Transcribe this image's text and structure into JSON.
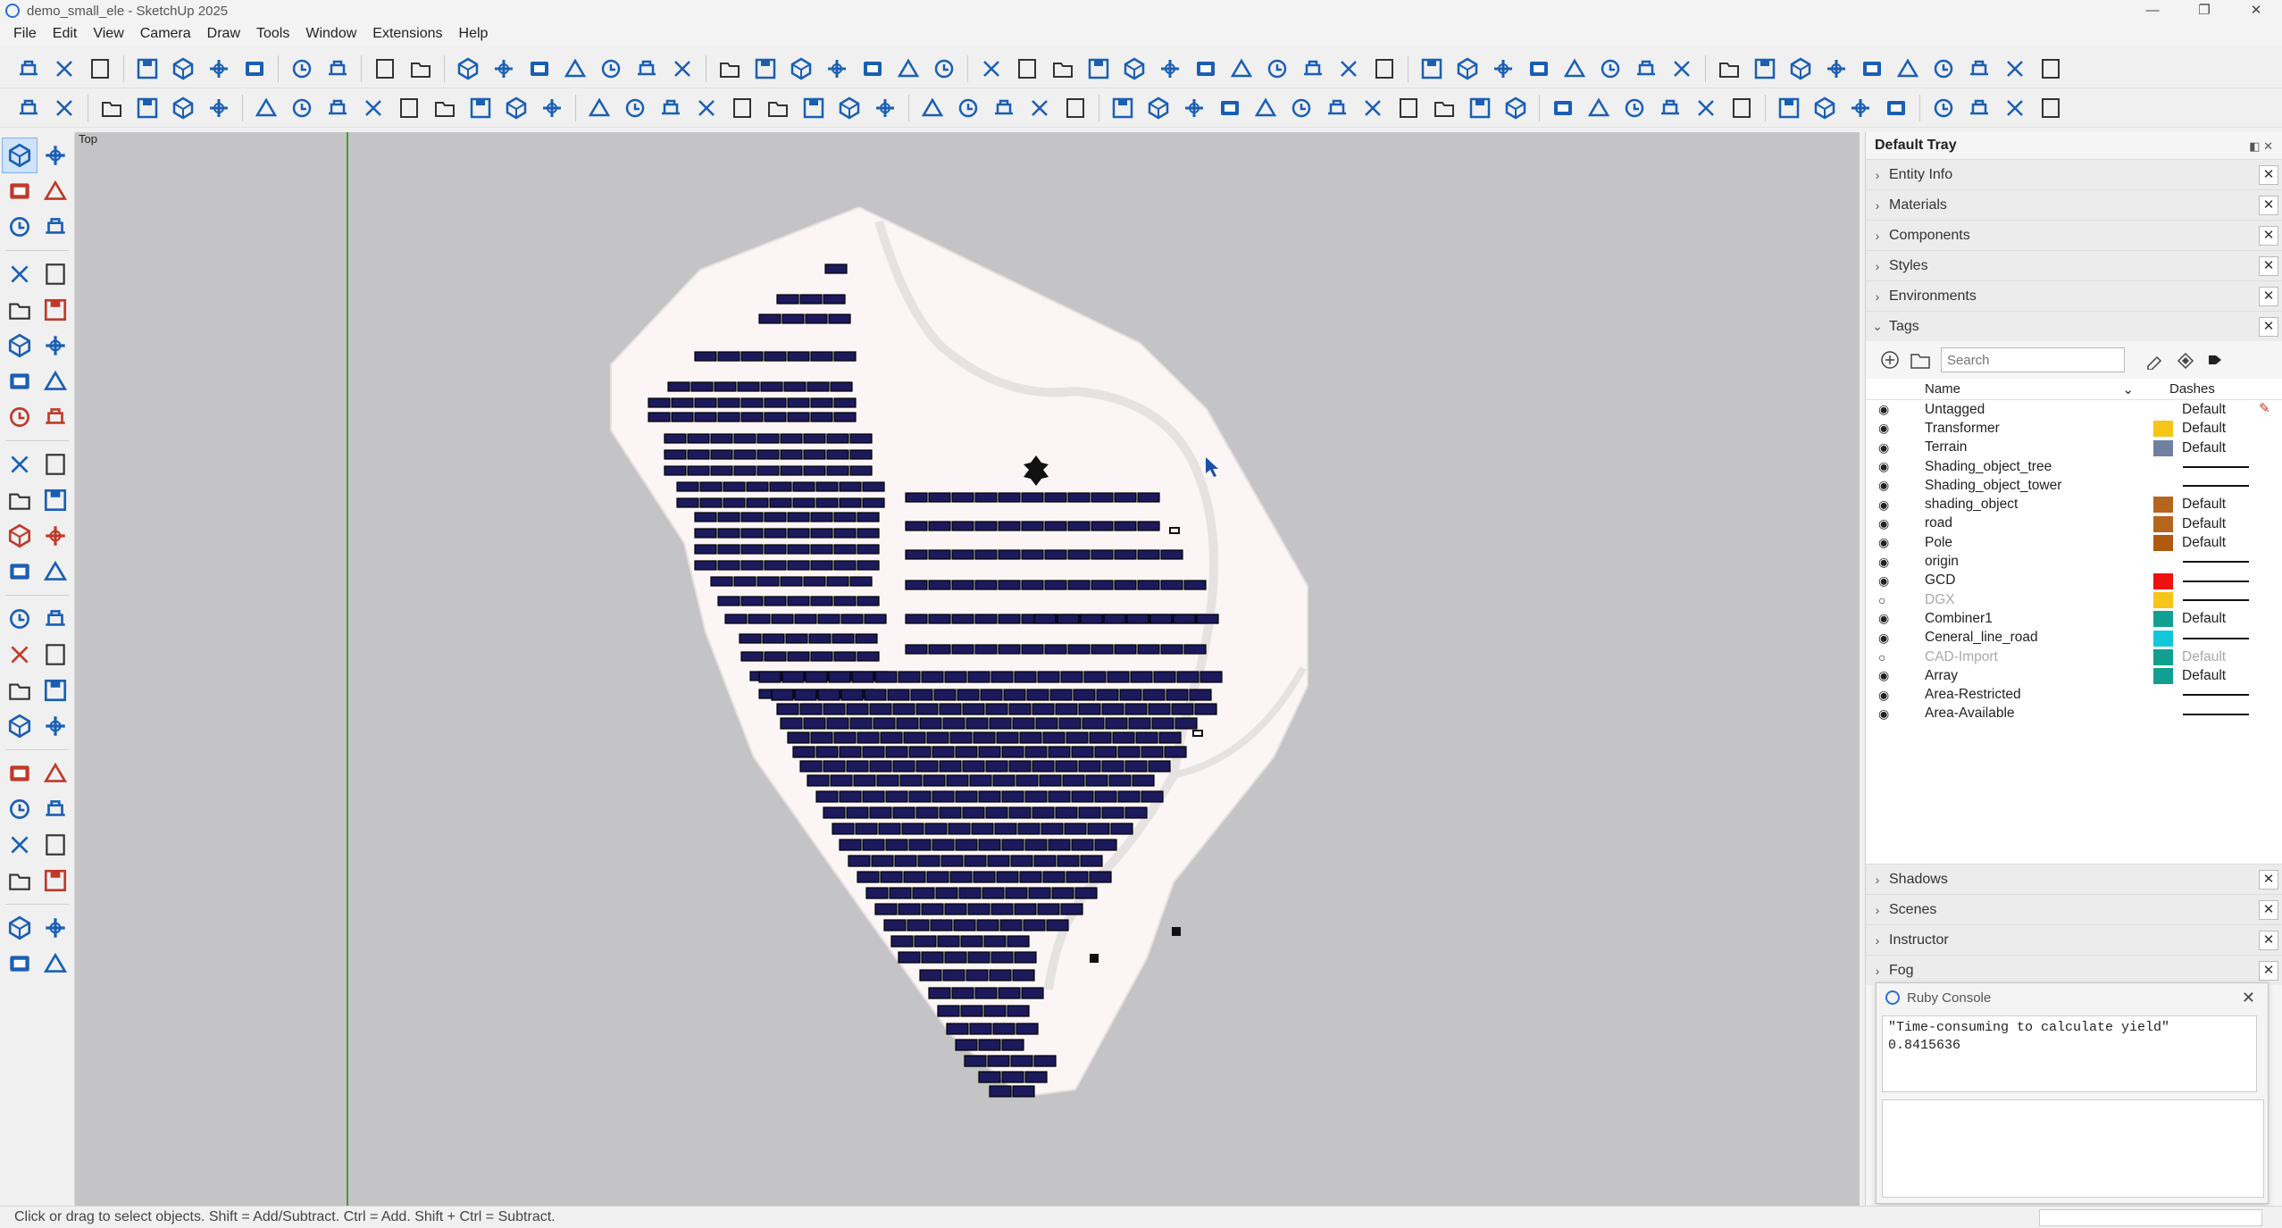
{
  "window": {
    "title": "demo_small_ele - SketchUp 2025"
  },
  "menu": [
    "File",
    "Edit",
    "View",
    "Camera",
    "Draw",
    "Tools",
    "Window",
    "Extensions",
    "Help"
  ],
  "viewport": {
    "view_label": "Top"
  },
  "status": {
    "text": "Click or drag to select objects. Shift = Add/Subtract. Ctrl = Add. Shift + Ctrl = Subtract."
  },
  "tray": {
    "title": "Default Tray",
    "panels_top": [
      "Entity Info",
      "Materials",
      "Components",
      "Styles",
      "Environments"
    ],
    "tags_panel": "Tags",
    "search_placeholder": "Search",
    "columns": {
      "name": "Name",
      "dashes": "Dashes"
    },
    "tags": [
      {
        "name": "Untagged",
        "visible": true,
        "color": "",
        "dashes": "Default",
        "editing": true
      },
      {
        "name": "Transformer",
        "visible": true,
        "color": "#f5c518",
        "dashes": "Default"
      },
      {
        "name": "Terrain",
        "visible": true,
        "color": "#7080a0",
        "dashes": "Default"
      },
      {
        "name": "Shading_object_tree",
        "visible": true,
        "color": "",
        "dashes": "line"
      },
      {
        "name": "Shading_object_tower",
        "visible": true,
        "color": "",
        "dashes": "line"
      },
      {
        "name": "shading_object",
        "visible": true,
        "color": "#b5651d",
        "dashes": "Default"
      },
      {
        "name": "road",
        "visible": true,
        "color": "#b5651d",
        "dashes": "Default"
      },
      {
        "name": "Pole",
        "visible": true,
        "color": "#b05a10",
        "dashes": "Default"
      },
      {
        "name": "origin",
        "visible": true,
        "color": "",
        "dashes": "line"
      },
      {
        "name": "GCD",
        "visible": true,
        "color": "#ee1111",
        "dashes": "line"
      },
      {
        "name": "DGX",
        "visible": false,
        "color": "#f5c518",
        "dashes": "line"
      },
      {
        "name": "Combiner1",
        "visible": true,
        "color": "#11a090",
        "dashes": "Default"
      },
      {
        "name": "Ceneral_line_road",
        "visible": true,
        "color": "#11c8d8",
        "dashes": "line"
      },
      {
        "name": "CAD-Import",
        "visible": false,
        "color": "#11a090",
        "dashes": "Default"
      },
      {
        "name": "Array",
        "visible": true,
        "color": "#11a090",
        "dashes": "Default"
      },
      {
        "name": "Area-Restricted",
        "visible": true,
        "color": "",
        "dashes": "line"
      },
      {
        "name": "Area-Available",
        "visible": true,
        "color": "",
        "dashes": "line"
      }
    ],
    "panels_bottom": [
      "Shadows",
      "Scenes",
      "Instructor",
      "Fog"
    ]
  },
  "ruby_console": {
    "title": "Ruby Console",
    "output": [
      "\"Time-consuming to calculate yield\"",
      "0.8415636"
    ]
  },
  "icons": {
    "toolbar1": [
      "new-icon",
      "open-icon",
      "save-icon",
      "sep",
      "cut-icon",
      "copy-icon",
      "paste-icon",
      "erase-icon",
      "sep",
      "undo-icon",
      "redo-icon",
      "sep",
      "print-icon",
      "model-info-icon",
      "sep",
      "iso-view-icon",
      "top-view-icon",
      "front-view-icon",
      "right-view-icon",
      "back-view-icon",
      "left-view-icon",
      "bottom-view-icon",
      "sep",
      "xray-icon",
      "backedges-icon",
      "wireframe-icon",
      "hidden-line-icon",
      "shaded-icon",
      "shaded-texture-icon",
      "monochrome-icon",
      "sep",
      "house-icon",
      "text-icon",
      "tree-icon",
      "pin-icon",
      "wind-icon",
      "tower-icon",
      "cube-icon",
      "grid-icon",
      "image-icon",
      "resize-icon",
      "hide-icon",
      "slope-icon",
      "sep",
      "search-icon",
      "angle-icon",
      "vertical-icon",
      "pen-icon",
      "transfer-icon",
      "list-icon",
      "lock-icon",
      "ramp-icon",
      "sep",
      "network-icon",
      "car-icon",
      "table-icon",
      "battery-icon",
      "export-icon",
      "panel-icon",
      "auto-icon",
      "arrow-icon",
      "tile-icon",
      "cross-icon"
    ],
    "toolbar2": [
      "menu-icon",
      "sun-icon",
      "sep",
      "globe-icon",
      "frame-icon",
      "terrain-icon",
      "mountain-icon",
      "sep",
      "panel-array-icon",
      "panels-icon",
      "grid-array-icon",
      "tilted-icon",
      "delete-icon",
      "percent-icon",
      "wand-icon",
      "wand2-icon",
      "cable-icon",
      "sep",
      "layout-icon",
      "screen-icon",
      "switch-icon",
      "magnifier-icon",
      "water-icon",
      "magnifier2-icon",
      "compass-icon",
      "link-icon",
      "comb-icon",
      "sep",
      "node-icon",
      "cube2-icon",
      "hospital-icon",
      "cloud-cad-icon",
      "ruler-icon",
      "sep",
      "tree-graph-icon",
      "edit-image-icon",
      "plane-icon",
      "move-axes-icon",
      "grid2-icon",
      "sliders-icon",
      "dropbox-icon",
      "coins-icon",
      "yen-icon",
      "kwh-icon",
      "irr-icon",
      "clipboard-icon",
      "sep",
      "gear-icon",
      "ruler2-icon",
      "en-icon",
      "help-icon",
      "cloud-icon",
      "refresh-icon",
      "sep",
      "database-icon",
      "loss-icon",
      "bi-icon",
      "play-icon",
      "sep",
      "vector-icon",
      "scissors-icon",
      "chart-icon",
      "obj-icon"
    ]
  },
  "chart_data": null
}
